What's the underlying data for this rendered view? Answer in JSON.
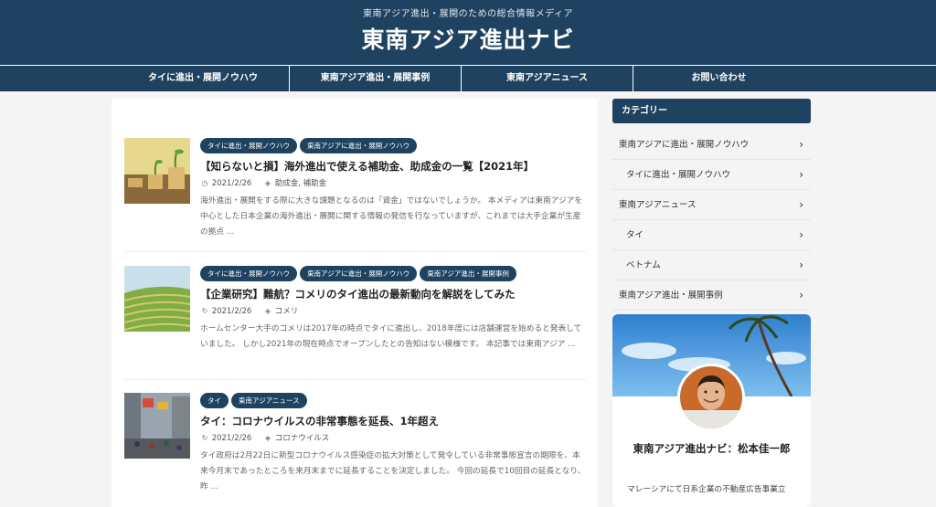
{
  "header": {
    "tagline": "東南アジア進出・展開のための総合情報メディア",
    "site_title": "東南アジア進出ナビ"
  },
  "nav": [
    {
      "label": "タイに進出・展開ノウハウ"
    },
    {
      "label": "東南アジア進出・展開事例"
    },
    {
      "label": "東南アジアニュース"
    },
    {
      "label": "お問い合わせ"
    }
  ],
  "articles": [
    {
      "tags": [
        "タイに進出・展開ノウハウ",
        "東南アジアに進出・展開ノウハウ"
      ],
      "title": "【知らないと損】海外進出で使える補助金、助成金の一覧【2021年】",
      "date": "2021/2/26",
      "date_icon": "clock-icon",
      "category": "助成金, 補助金",
      "excerpt": "海外進出・展開をする際に大きな課題となるのは「資金」ではないでしょうか。 本メディアは東南アジアを中心とした日本企業の海外進出・展開に関する情報の発信を行なっていますが、これまでは大手企業が生産の拠点 ..."
    },
    {
      "tags": [
        "タイに進出・展開ノウハウ",
        "東南アジアに進出・展開ノウハウ",
        "東南アジア進出・展開事例"
      ],
      "title": "【企業研究】難航？コメリのタイ進出の最新動向を解説をしてみた",
      "date": "2021/2/26",
      "date_icon": "refresh-icon",
      "category": "コメリ",
      "excerpt": "ホームセンター大手のコメリは2017年の時点でタイに進出し、2018年度には店舗運営を始めると発表していました。 しかし2021年の現在時点でオープンしたとの告知はない模様です。 本記事では東南アジア ..."
    },
    {
      "tags": [
        "タイ",
        "東南アジアニュース"
      ],
      "title": "タイ：コロナウイルスの非常事態を延長、1年超え",
      "date": "2021/2/26",
      "date_icon": "refresh-icon",
      "category": "コロナウイルス",
      "excerpt": "タイ政府は2月22日に新型コロナウイルス感染症の拡大対策として発令している非常事態宣言の期限を、本来今月末であったところを来月末までに延長することを決定しました。 今回の延長で10回目の延長となり、昨 ..."
    }
  ],
  "sidebar": {
    "heading": "カテゴリー",
    "categories": [
      {
        "label": "東南アジアに進出・展開ノウハウ",
        "indent": false
      },
      {
        "label": "タイに進出・展開ノウハウ",
        "indent": true
      },
      {
        "label": "東南アジアニュース",
        "indent": false
      },
      {
        "label": "タイ",
        "indent": true
      },
      {
        "label": "ベトナム",
        "indent": true
      },
      {
        "label": "東南アジア進出・展開事例",
        "indent": false
      }
    ],
    "chevron": "›",
    "profile": {
      "name": "東南アジア進出ナビ：松本佳一郎",
      "description": "マレーシアにて日系企業の不動産広告事業立"
    }
  },
  "colors": {
    "brand": "#1e4260",
    "background": "#f4f4f4"
  }
}
